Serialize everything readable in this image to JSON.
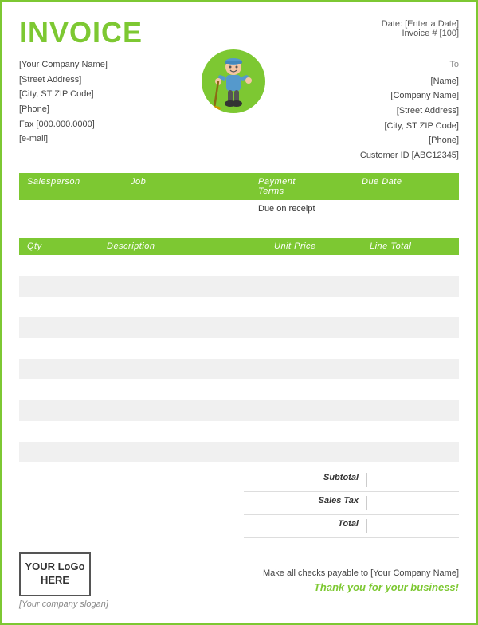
{
  "header": {
    "title": "INVOICE",
    "date_label": "Date:",
    "date_value": "[Enter a Date]",
    "invoice_label": "Invoice #",
    "invoice_number": "[100]"
  },
  "sender": {
    "company": "[Your Company Name]",
    "address": "[Street Address]",
    "city": "[City, ST  ZIP Code]",
    "phone": "[Phone]",
    "fax": "Fax [000.000.0000]",
    "email": "[e-mail]"
  },
  "to_label": "To",
  "recipient": {
    "name": "[Name]",
    "company": "[Company Name]",
    "address": "[Street Address]",
    "city": "[City, ST  ZIP Code]",
    "phone": "[Phone]",
    "customer_id": "Customer ID [ABC12345]"
  },
  "job_table": {
    "headers": [
      "Salesperson",
      "Job",
      "Payment Terms",
      "Due Date"
    ],
    "row": [
      "",
      "",
      "Due on receipt",
      ""
    ]
  },
  "items_table": {
    "headers": [
      "Qty",
      "Description",
      "Unit Price",
      "Line Total"
    ],
    "rows": [
      [
        "",
        "",
        "",
        ""
      ],
      [
        "",
        "",
        "",
        ""
      ],
      [
        "",
        "",
        "",
        ""
      ],
      [
        "",
        "",
        "",
        ""
      ],
      [
        "",
        "",
        "",
        ""
      ],
      [
        "",
        "",
        "",
        ""
      ],
      [
        "",
        "",
        "",
        ""
      ],
      [
        "",
        "",
        "",
        ""
      ],
      [
        "",
        "",
        "",
        ""
      ],
      [
        "",
        "",
        "",
        ""
      ]
    ]
  },
  "totals": {
    "subtotal_label": "Subtotal",
    "tax_label": "Sales Tax",
    "total_label": "Total",
    "subtotal_value": "",
    "tax_value": "",
    "total_value": ""
  },
  "footer": {
    "logo_text": "YOUR LoGo HERE",
    "slogan": "[Your company slogan]",
    "checks_text": "Make all checks payable to [Your Company Name]",
    "thank_you": "Thank you for your business!"
  }
}
